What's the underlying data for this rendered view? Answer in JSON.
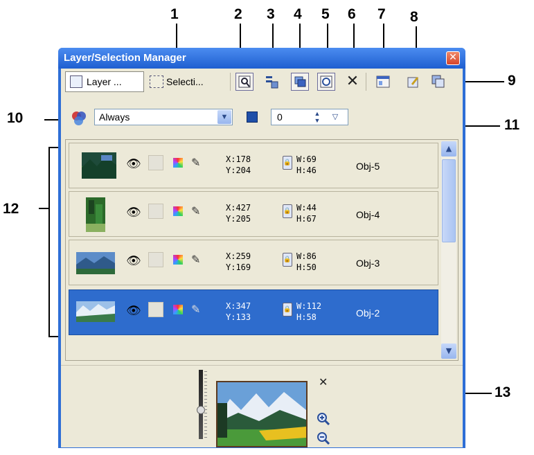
{
  "window": {
    "title": "Layer/Selection Manager",
    "close_glyph": "✕"
  },
  "toolbar": {
    "layer_tab": "Layer ...",
    "selection_tab": "Selecti...",
    "icons": [
      "layer-tab-icon",
      "selection-tab-icon",
      "zoom-to-object-icon",
      "arrange-icon",
      "merge-icon",
      "center-icon",
      "delete-icon",
      "properties-icon",
      "pin-icon",
      "combine-icon"
    ]
  },
  "mode": {
    "value": "Always"
  },
  "opacity": {
    "value": "0"
  },
  "layers": [
    {
      "x": "X:178",
      "y": "Y:204",
      "w": "W:69",
      "h": "H:46",
      "name": "Obj-5",
      "selected": false
    },
    {
      "x": "X:427",
      "y": "Y:205",
      "w": "W:44",
      "h": "H:67",
      "name": "Obj-4",
      "selected": false
    },
    {
      "x": "X:259",
      "y": "Y:169",
      "w": "W:86",
      "h": "H:50",
      "name": "Obj-3",
      "selected": false
    },
    {
      "x": "X:347",
      "y": "Y:133",
      "w": "W:112",
      "h": "H:58",
      "name": "Obj-2",
      "selected": true
    }
  ],
  "navigator": {
    "close_glyph": "✕"
  },
  "callouts": [
    "1",
    "2",
    "3",
    "4",
    "5",
    "6",
    "7",
    "8",
    "9",
    "10",
    "11",
    "12",
    "13"
  ]
}
